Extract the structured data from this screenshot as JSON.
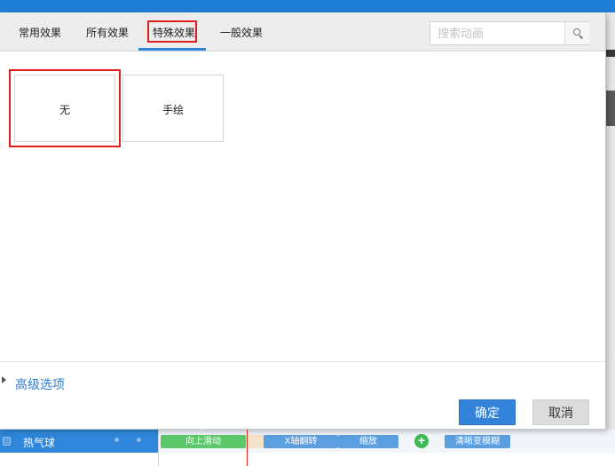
{
  "dialog": {
    "tabs": [
      {
        "label": "常用效果",
        "active": false
      },
      {
        "label": "所有效果",
        "active": false
      },
      {
        "label": "特殊效果",
        "active": true
      },
      {
        "label": "一般效果",
        "active": false
      }
    ],
    "search": {
      "placeholder": "搜索动画",
      "value": "",
      "icon": "search-icon"
    },
    "effects": [
      {
        "label": "无",
        "selected": true
      },
      {
        "label": "手绘",
        "selected": false
      }
    ],
    "advanced_label": "高级选项",
    "confirm_label": "确定",
    "cancel_label": "取消"
  },
  "timeline": {
    "layer_name": "热气球",
    "animations": [
      {
        "label": "向上滑动",
        "color": "#5cc86a"
      },
      {
        "label": "X轴翻转",
        "color": "#5b9fe0"
      },
      {
        "label": "缩放",
        "color": "#5b9fe0"
      },
      {
        "label": "清晰变模糊",
        "color": "#5b9fe0"
      }
    ],
    "add_icon": "plus-icon"
  },
  "colors": {
    "accent": "#2f86da",
    "highlight": "#e02020",
    "confirm": "#3483db"
  }
}
